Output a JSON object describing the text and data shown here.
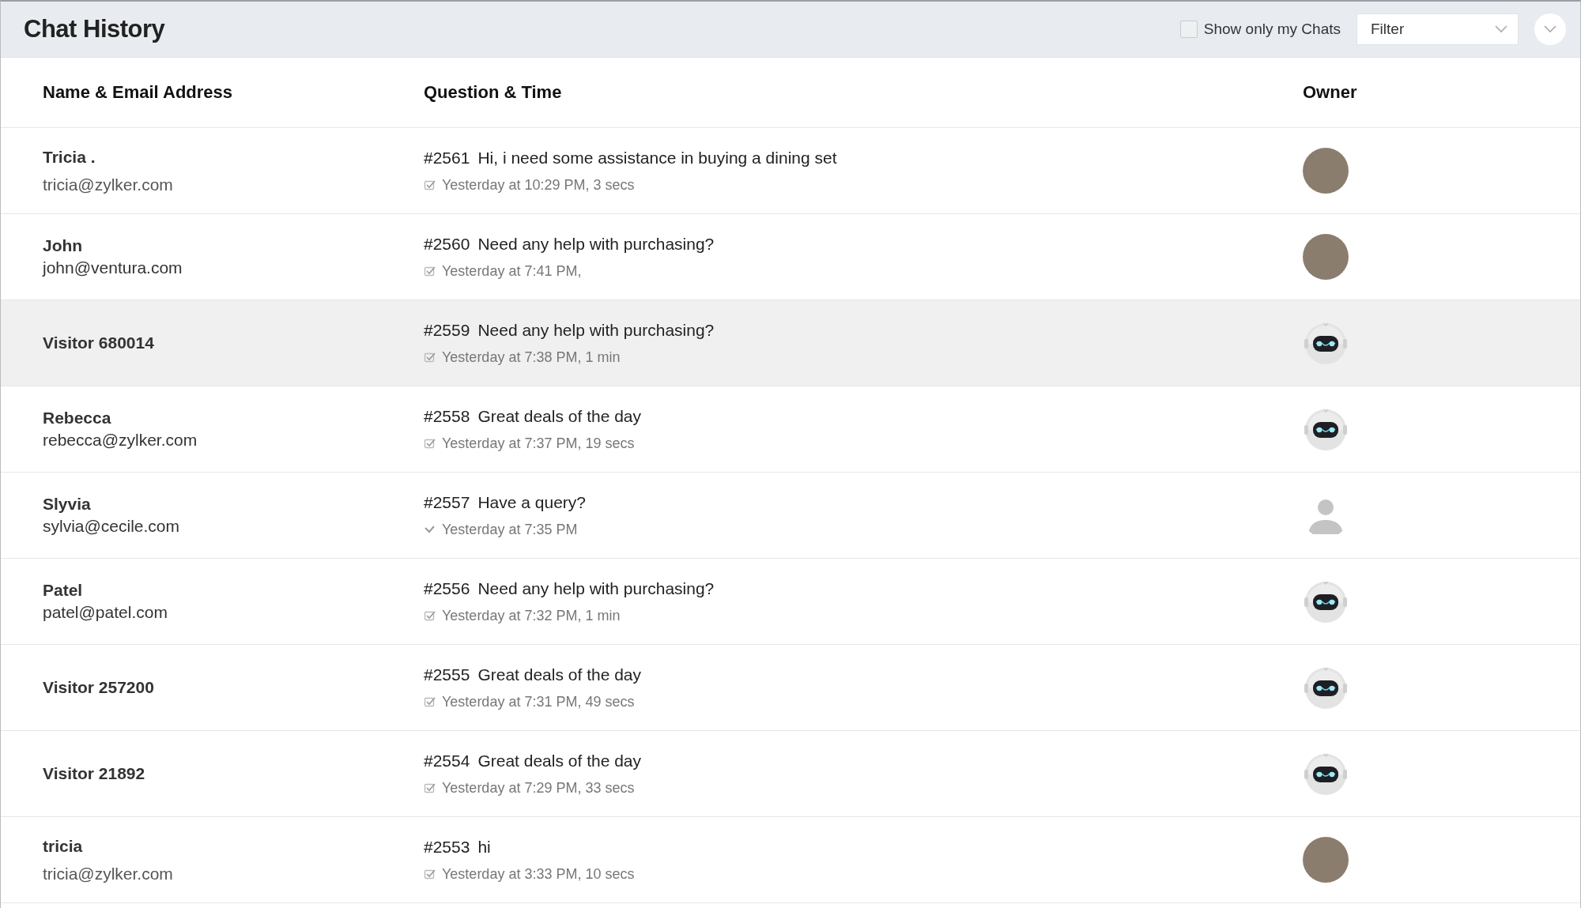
{
  "header": {
    "title": "Chat History",
    "show_only_mine": {
      "label": "Show only my Chats",
      "checked": false
    },
    "filter": {
      "value": "Filter"
    }
  },
  "table": {
    "columns": [
      "Name & Email Address",
      "Question & Time",
      "Owner"
    ],
    "rows": [
      {
        "kind": "spaced",
        "name": "Tricia .",
        "email": "tricia@zylker.com",
        "id": "#2561",
        "question": "Hi, i need some assistance in buying a dining set",
        "time": "Yesterday at 10:29 PM, 3 secs",
        "time_icon": {
          "kind": "checkbox"
        },
        "owner": {
          "kind": "photo"
        },
        "selected": false
      },
      {
        "kind": "stacked",
        "name": "John",
        "email": "john@ventura.com",
        "id": "#2560",
        "question": "Need any help with purchasing?",
        "time": "Yesterday at 7:41 PM,",
        "time_icon": {
          "kind": "checkbox"
        },
        "owner": {
          "kind": "photo"
        },
        "selected": false
      },
      {
        "kind": "stacked",
        "name": "Visitor 680014",
        "id": "#2559",
        "question": "Need any help with purchasing?",
        "time": "Yesterday at 7:38 PM, 1 min",
        "time_icon": {
          "kind": "checkbox"
        },
        "owner": {
          "kind": "bot"
        },
        "selected": true
      },
      {
        "kind": "stacked",
        "name": "Rebecca",
        "email": "rebecca@zylker.com",
        "id": "#2558",
        "question": "Great deals of the day",
        "time": "Yesterday at 7:37 PM, 19 secs",
        "time_icon": {
          "kind": "checkbox"
        },
        "owner": {
          "kind": "bot"
        },
        "selected": false
      },
      {
        "kind": "stacked",
        "name": "Slyvia",
        "email": "sylvia@cecile.com",
        "id": "#2557",
        "question": "Have a query?",
        "time": "Yesterday at 7:35 PM",
        "time_icon": {
          "kind": "chevron"
        },
        "owner": {
          "kind": "silhouette"
        },
        "selected": false
      },
      {
        "kind": "stacked",
        "name": "Patel",
        "email": "patel@patel.com",
        "id": "#2556",
        "question": "Need any help with purchasing?",
        "time": "Yesterday at 7:32 PM, 1 min",
        "time_icon": {
          "kind": "checkbox"
        },
        "owner": {
          "kind": "bot"
        },
        "selected": false
      },
      {
        "kind": "stacked",
        "name": "Visitor 257200",
        "id": "#2555",
        "question": "Great deals of the day",
        "time": "Yesterday at 7:31 PM, 49 secs",
        "time_icon": {
          "kind": "checkbox"
        },
        "owner": {
          "kind": "bot"
        },
        "selected": false
      },
      {
        "kind": "stacked",
        "name": "Visitor 21892",
        "id": "#2554",
        "question": "Great deals of the day",
        "time": "Yesterday at 7:29 PM, 33 secs",
        "time_icon": {
          "kind": "checkbox"
        },
        "owner": {
          "kind": "bot"
        },
        "selected": false
      },
      {
        "kind": "spaced",
        "name": "tricia",
        "email": "tricia@zylker.com",
        "id": "#2553",
        "question": "hi",
        "time": "Yesterday at 3:33 PM, 10 secs",
        "time_icon": {
          "kind": "checkbox"
        },
        "owner": {
          "kind": "photo"
        },
        "selected": false
      }
    ]
  }
}
